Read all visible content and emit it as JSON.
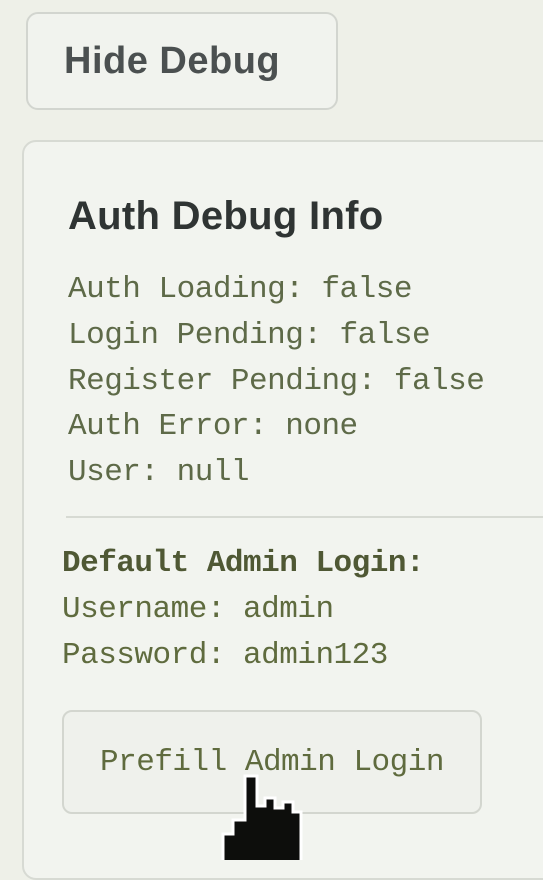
{
  "hide_debug_label": "Hide Debug",
  "panel": {
    "title": "Auth Debug Info",
    "status_lines": [
      "Auth Loading: false",
      "Login Pending: false",
      "Register Pending: false",
      "Auth Error: none",
      "User: null"
    ],
    "credentials_heading": "Default Admin Login:",
    "username_line": "Username: admin",
    "password_line": "Password: admin123",
    "prefill_label": "Prefill Admin Login"
  }
}
